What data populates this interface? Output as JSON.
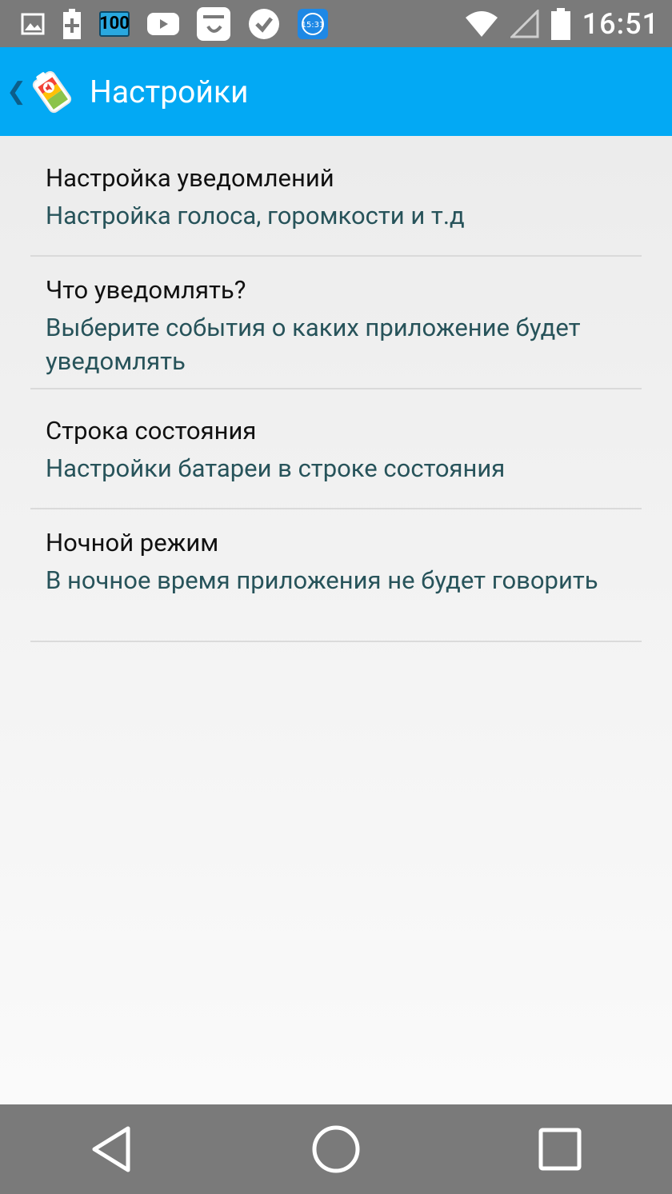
{
  "status_bar": {
    "time": "16:51",
    "battery_badge": "100",
    "notification_icons": [
      "image-icon",
      "battery-plus-icon",
      "battery-100-icon",
      "youtube-icon",
      "app-icon",
      "check-badge-icon",
      "clock-app-icon"
    ],
    "colors": {
      "background": "#7a7a7a",
      "foreground": "#ffffff"
    }
  },
  "app_bar": {
    "title": "Настройки",
    "color": "#03a9f4"
  },
  "preferences": [
    {
      "title": "Настройка уведомлений",
      "summary": "Настройка голоса, горомкости и т.д"
    },
    {
      "title": "Что уведомлять?",
      "summary": "Выберите события о каких приложение будет уведомлять"
    },
    {
      "title": "Строка состояния",
      "summary": "Настройки батареи в строке состояния"
    },
    {
      "title": "Ночной режим",
      "summary": "В ночное время приложения не будет говорить"
    }
  ],
  "nav_bar": {
    "buttons": [
      "back-icon",
      "home-icon",
      "recents-icon"
    ]
  }
}
